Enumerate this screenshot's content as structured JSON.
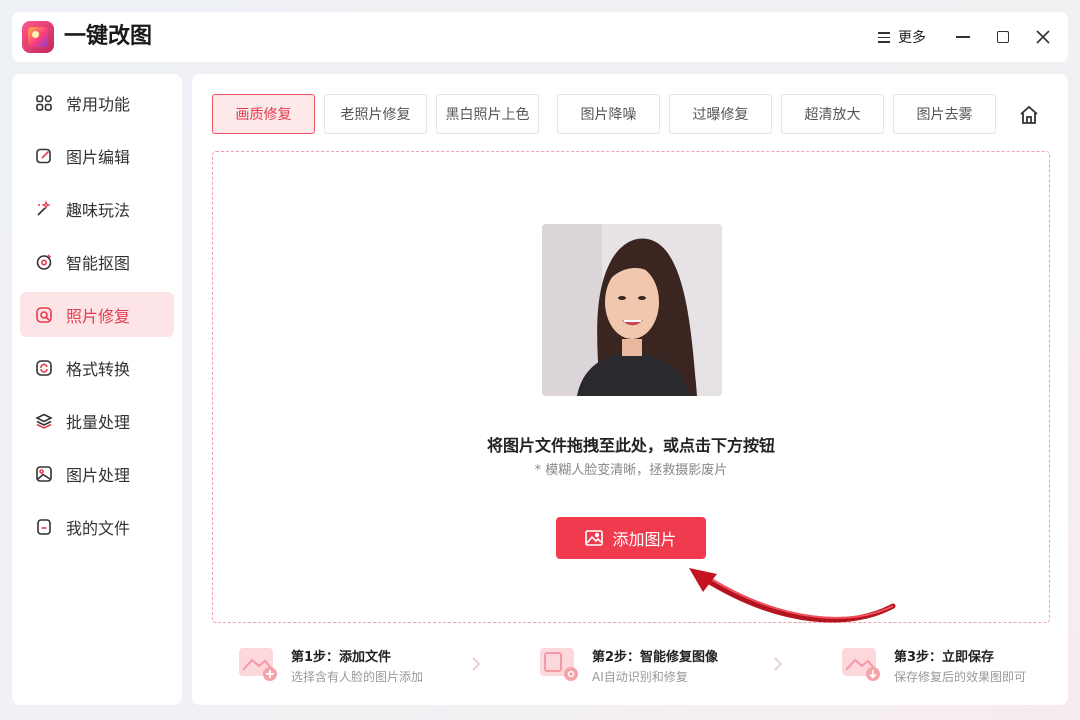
{
  "app": {
    "title": "一键改图"
  },
  "titlebar": {
    "more_label": "更多"
  },
  "sidebar": {
    "items": [
      {
        "label": "常用功能",
        "icon": "grid-icon",
        "active": false
      },
      {
        "label": "图片编辑",
        "icon": "edit-icon",
        "active": false
      },
      {
        "label": "趣味玩法",
        "icon": "magic-wand-icon",
        "active": false
      },
      {
        "label": "智能抠图",
        "icon": "target-icon",
        "active": false
      },
      {
        "label": "照片修复",
        "icon": "repair-icon",
        "active": true
      },
      {
        "label": "格式转换",
        "icon": "convert-icon",
        "active": false
      },
      {
        "label": "批量处理",
        "icon": "layers-icon",
        "active": false
      },
      {
        "label": "图片处理",
        "icon": "image-icon",
        "active": false
      },
      {
        "label": "我的文件",
        "icon": "file-icon",
        "active": false
      }
    ]
  },
  "tabs": [
    {
      "label": "画质修复",
      "active": true
    },
    {
      "label": "老照片修复",
      "active": false
    },
    {
      "label": "黑白照片上色",
      "active": false
    },
    {
      "label": "图片降噪",
      "active": false
    },
    {
      "label": "过曝修复",
      "active": false
    },
    {
      "label": "超清放大",
      "active": false
    },
    {
      "label": "图片去雾",
      "active": false
    }
  ],
  "dropzone": {
    "main_text": "将图片文件拖拽至此处，或点击下方按钮",
    "sub_text": "* 模糊人脸变清晰，拯救摄影废片",
    "button_label": "添加图片"
  },
  "steps": [
    {
      "title": "第1步：添加文件",
      "desc": "选择含有人脸的图片添加"
    },
    {
      "title": "第2步：智能修复图像",
      "desc": "AI自动识别和修复"
    },
    {
      "title": "第3步：立即保存",
      "desc": "保存修复后的效果图即可"
    }
  ],
  "colors": {
    "accent": "#f03a4d",
    "active_bg": "#fde4e6"
  }
}
